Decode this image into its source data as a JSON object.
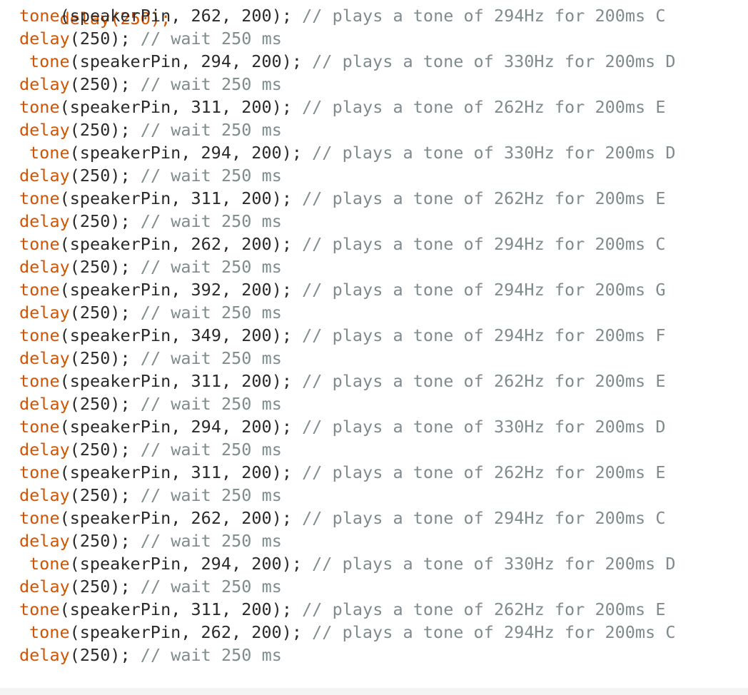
{
  "editor": {
    "colors": {
      "background": "#ffffff",
      "function": "#d35400",
      "comment": "#7f8c8d",
      "text": "#2a2a2a"
    },
    "partial_top_line": {
      "text": "delay(250);"
    },
    "lines": [
      {
        "indent": 2,
        "fn": "tone",
        "args": "(speakerPin, 262, 200); ",
        "comment": "// plays a tone of 294Hz for 200ms C"
      },
      {
        "indent": 2,
        "fn": "delay",
        "args": "(250); ",
        "comment": "// wait 250 ms"
      },
      {
        "indent": 3,
        "fn": "tone",
        "args": "(speakerPin, 294, 200); ",
        "comment": "// plays a tone of 330Hz for 200ms D"
      },
      {
        "indent": 2,
        "fn": "delay",
        "args": "(250); ",
        "comment": "// wait 250 ms"
      },
      {
        "indent": 2,
        "fn": "tone",
        "args": "(speakerPin, 311, 200); ",
        "comment": "// plays a tone of 262Hz for 200ms E"
      },
      {
        "indent": 2,
        "fn": "delay",
        "args": "(250); ",
        "comment": "// wait 250 ms"
      },
      {
        "indent": 3,
        "fn": "tone",
        "args": "(speakerPin, 294, 200); ",
        "comment": "// plays a tone of 330Hz for 200ms D"
      },
      {
        "indent": 2,
        "fn": "delay",
        "args": "(250); ",
        "comment": "// wait 250 ms"
      },
      {
        "indent": 2,
        "fn": "tone",
        "args": "(speakerPin, 311, 200); ",
        "comment": "// plays a tone of 262Hz for 200ms E"
      },
      {
        "indent": 2,
        "fn": "delay",
        "args": "(250); ",
        "comment": "// wait 250 ms"
      },
      {
        "indent": 2,
        "fn": "tone",
        "args": "(speakerPin, 262, 200); ",
        "comment": "// plays a tone of 294Hz for 200ms C"
      },
      {
        "indent": 2,
        "fn": "delay",
        "args": "(250); ",
        "comment": "// wait 250 ms"
      },
      {
        "indent": 2,
        "fn": "tone",
        "args": "(speakerPin, 392, 200); ",
        "comment": "// plays a tone of 294Hz for 200ms G"
      },
      {
        "indent": 2,
        "fn": "delay",
        "args": "(250); ",
        "comment": "// wait 250 ms"
      },
      {
        "indent": 2,
        "fn": "tone",
        "args": "(speakerPin, 349, 200); ",
        "comment": "// plays a tone of 294Hz for 200ms F"
      },
      {
        "indent": 2,
        "fn": "delay",
        "args": "(250); ",
        "comment": "// wait 250 ms"
      },
      {
        "indent": 2,
        "fn": "tone",
        "args": "(speakerPin, 311, 200); ",
        "comment": "// plays a tone of 262Hz for 200ms E"
      },
      {
        "indent": 2,
        "fn": "delay",
        "args": "(250); ",
        "comment": "// wait 250 ms"
      },
      {
        "indent": 2,
        "fn": "tone",
        "args": "(speakerPin, 294, 200); ",
        "comment": "// plays a tone of 330Hz for 200ms D"
      },
      {
        "indent": 2,
        "fn": "delay",
        "args": "(250); ",
        "comment": "// wait 250 ms"
      },
      {
        "indent": 2,
        "fn": "tone",
        "args": "(speakerPin, 311, 200); ",
        "comment": "// plays a tone of 262Hz for 200ms E"
      },
      {
        "indent": 2,
        "fn": "delay",
        "args": "(250); ",
        "comment": "// wait 250 ms"
      },
      {
        "indent": 2,
        "fn": "tone",
        "args": "(speakerPin, 262, 200); ",
        "comment": "// plays a tone of 294Hz for 200ms C"
      },
      {
        "indent": 2,
        "fn": "delay",
        "args": "(250); ",
        "comment": "// wait 250 ms"
      },
      {
        "indent": 3,
        "fn": "tone",
        "args": "(speakerPin, 294, 200); ",
        "comment": "// plays a tone of 330Hz for 200ms D"
      },
      {
        "indent": 2,
        "fn": "delay",
        "args": "(250); ",
        "comment": "// wait 250 ms"
      },
      {
        "indent": 2,
        "fn": "tone",
        "args": "(speakerPin, 311, 200); ",
        "comment": "// plays a tone of 262Hz for 200ms E"
      },
      {
        "indent": 3,
        "fn": "tone",
        "args": "(speakerPin, 262, 200); ",
        "comment": "// plays a tone of 294Hz for 200ms C"
      },
      {
        "indent": 2,
        "fn": "delay",
        "args": "(250); ",
        "comment": "// wait 250 ms"
      }
    ],
    "closing_brace": "}"
  }
}
